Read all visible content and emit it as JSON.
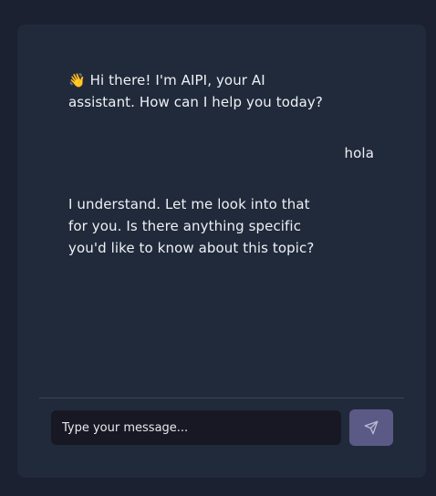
{
  "messages": [
    {
      "role": "assistant",
      "text": "👋 Hi there! I'm AIPI, your AI\nassistant. How can I help you today?"
    },
    {
      "role": "user",
      "text": "hola"
    },
    {
      "role": "assistant",
      "text": "I understand. Let me look into that\nfor you. Is there anything specific\nyou'd like to know about this topic?"
    }
  ],
  "composer": {
    "placeholder": "Type your message...",
    "value": "",
    "send_icon": "send-icon"
  },
  "colors": {
    "page_background": "#1b2130",
    "panel_background": "#212a3a",
    "input_background": "#181824",
    "send_button": "#5b5a86",
    "text": "#eef1f6"
  }
}
